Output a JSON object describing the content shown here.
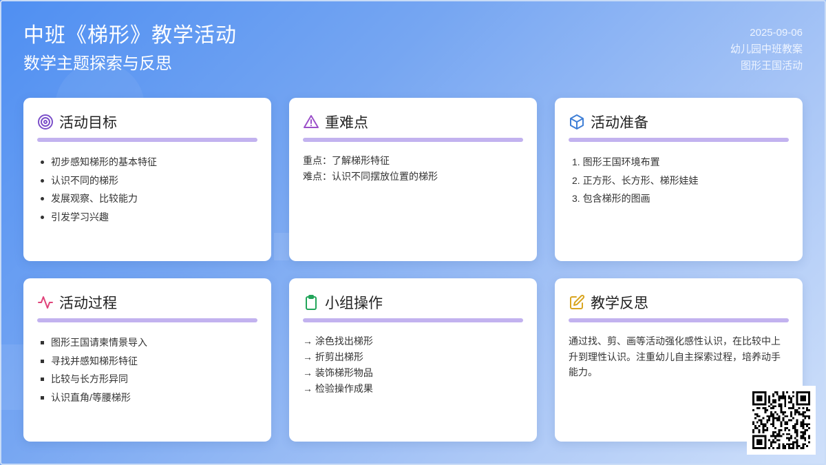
{
  "header": {
    "title": "中班《梯形》教学活动",
    "subtitle": "数学主题探索与反思"
  },
  "meta": {
    "date": "2025-09-06",
    "line2": "幼儿园中班教案",
    "line3": "图形王国活动"
  },
  "cards": {
    "goals": {
      "title": "活动目标",
      "icon": "target-icon",
      "items": [
        "初步感知梯形的基本特征",
        "认识不同的梯形",
        "发展观察、比较能力",
        "引发学习兴趣"
      ]
    },
    "key_points": {
      "title": "重难点",
      "icon": "warning-icon",
      "lines": [
        "重点：了解梯形特征",
        "难点：认识不同摆放位置的梯形"
      ]
    },
    "preparation": {
      "title": "活动准备",
      "icon": "cube-icon",
      "items": [
        "1. 图形王国环境布置",
        "2. 正方形、长方形、梯形娃娃",
        "3. 包含梯形的图画"
      ]
    },
    "process": {
      "title": "活动过程",
      "icon": "activity-icon",
      "items": [
        "图形王国请柬情景导入",
        "寻找并感知梯形特征",
        "比较与长方形异同",
        "认识直角/等腰梯形"
      ]
    },
    "group": {
      "title": "小组操作",
      "icon": "clipboard-icon",
      "items": [
        "→ 涂色找出梯形",
        "→ 折剪出梯形",
        "→ 装饰梯形物品",
        "→ 检验操作成果"
      ]
    },
    "reflection": {
      "title": "教学反思",
      "icon": "edit-icon",
      "text": "通过找、剪、画等活动强化感性认识，在比较中上升到理性认识。注重幼儿自主探索过程，培养动手能力。"
    }
  },
  "colors": {
    "accent_bar": "#c2b2ef",
    "target_icon": "#7b4fc9",
    "warning_icon": "#9b4fc9",
    "cube_icon": "#3f7fd6",
    "activity_icon": "#e0447a",
    "clipboard_icon": "#22a55a",
    "edit_icon": "#d9a520"
  }
}
